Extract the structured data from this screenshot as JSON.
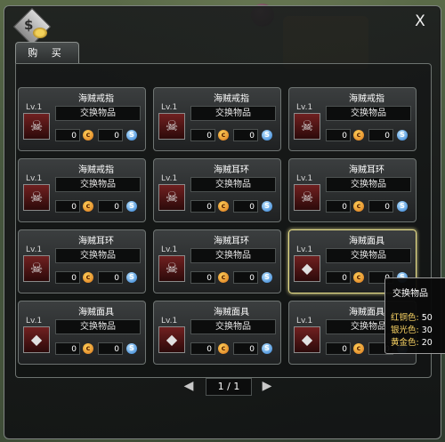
{
  "window": {
    "close_label": "X",
    "logo_symbol": "$"
  },
  "tab": {
    "label": "购 买"
  },
  "coin_glyph": "c",
  "silver_glyph": "S",
  "items": [
    {
      "name": "海贼戒指",
      "level": "Lv.1",
      "type": "交换物品",
      "gold": "0",
      "silver": "0",
      "icon": "ring-icon"
    },
    {
      "name": "海贼戒指",
      "level": "Lv.1",
      "type": "交换物品",
      "gold": "0",
      "silver": "0",
      "icon": "ring-icon"
    },
    {
      "name": "海贼戒指",
      "level": "Lv.1",
      "type": "交换物品",
      "gold": "0",
      "silver": "0",
      "icon": "ring-icon"
    },
    {
      "name": "海贼戒指",
      "level": "Lv.1",
      "type": "交换物品",
      "gold": "0",
      "silver": "0",
      "icon": "ring-icon"
    },
    {
      "name": "海贼耳环",
      "level": "Lv.1",
      "type": "交换物品",
      "gold": "0",
      "silver": "0",
      "icon": "earring-icon"
    },
    {
      "name": "海贼耳环",
      "level": "Lv.1",
      "type": "交换物品",
      "gold": "0",
      "silver": "0",
      "icon": "earring-icon"
    },
    {
      "name": "海贼耳环",
      "level": "Lv.1",
      "type": "交换物品",
      "gold": "0",
      "silver": "0",
      "icon": "earring-icon"
    },
    {
      "name": "海贼耳环",
      "level": "Lv.1",
      "type": "交换物品",
      "gold": "0",
      "silver": "0",
      "icon": "earring-icon"
    },
    {
      "name": "海贼面具",
      "level": "Lv.1",
      "type": "交换物品",
      "gold": "0",
      "silver": "0",
      "icon": "mask-icon"
    },
    {
      "name": "海贼面具",
      "level": "Lv.1",
      "type": "交换物品",
      "gold": "0",
      "silver": "0",
      "icon": "mask-icon"
    },
    {
      "name": "海贼面具",
      "level": "Lv.1",
      "type": "交换物品",
      "gold": "0",
      "silver": "0",
      "icon": "mask-icon"
    },
    {
      "name": "海贼面具",
      "level": "Lv.1",
      "type": "交换物品",
      "gold": "0",
      "silver": "0",
      "icon": "mask-icon"
    }
  ],
  "selected_index": 8,
  "pagination": {
    "current": "1 / 1",
    "prev": "◀",
    "next": "▶"
  },
  "tooltip": {
    "title": "交换物品",
    "rows": [
      {
        "label": "红铜色:",
        "value": "50"
      },
      {
        "label": "银光色:",
        "value": "30"
      },
      {
        "label": "黄金色:",
        "value": "20"
      }
    ]
  }
}
